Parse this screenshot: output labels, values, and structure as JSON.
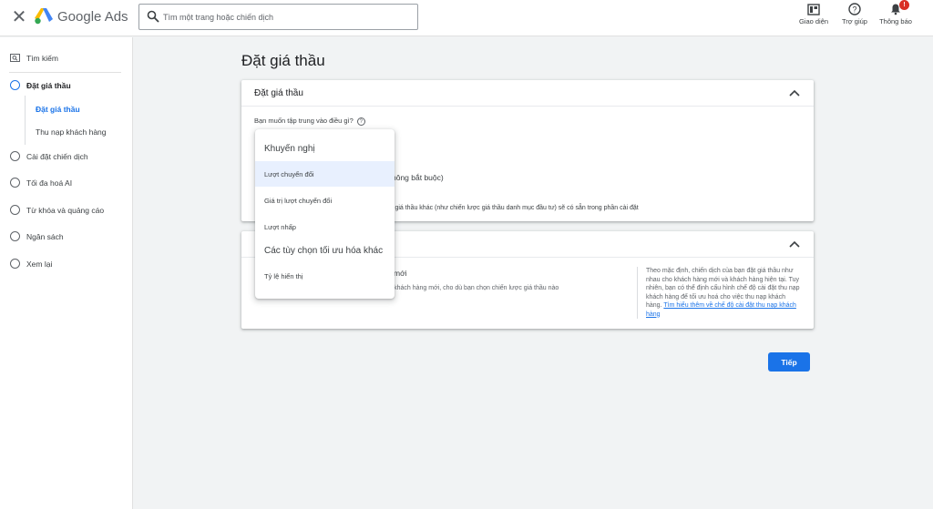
{
  "topbar": {
    "brand": "Google Ads",
    "search_placeholder": "Tìm một trang hoặc chiến dịch",
    "appearance_label": "Giao diện",
    "help_label": "Trợ giúp",
    "notifications_label": "Thông báo",
    "notifications_badge": "!"
  },
  "sidebar": {
    "search_label": "Tìm kiếm",
    "items": [
      {
        "label": "Đặt giá thầu"
      },
      {
        "label": "Cài đặt chiến dịch"
      },
      {
        "label": "Tối đa hoá AI"
      },
      {
        "label": "Từ khóa và quảng cáo"
      },
      {
        "label": "Ngân sách"
      },
      {
        "label": "Xem lại"
      }
    ],
    "sub_items": [
      {
        "label": "Đặt giá thầu"
      },
      {
        "label": "Thu nạp khách hàng"
      }
    ]
  },
  "main": {
    "page_title": "Đặt giá thầu",
    "card1": {
      "title": "Đặt giá thầu",
      "question": "Bạn muốn tập trung vào điều gì?",
      "help_icon": "?",
      "partial_optional": "hông bắt buộc)",
      "partial_note": "c giá thầu khác (như chiến lược giá thầu danh mục đầu tư) sẽ có sẵn trong phần cài đặt"
    },
    "card2": {
      "partial_title": "mới",
      "partial_desc": "ới khách hàng mới, cho dù bạn chọn chiến lược giá thầu nào",
      "side_note": "Theo mặc định, chiến dịch của bạn đặt giá thầu như nhau cho khách hàng mới và khách hàng hiện tại. Tuy nhiên, bạn có thể định cấu hình chế độ cài đặt thu nạp khách hàng để tối ưu hoá cho việc thu nạp khách hàng.",
      "side_link": "Tìm hiểu thêm về chế độ cài đặt thu nạp khách hàng"
    },
    "next_button": "Tiếp"
  },
  "dropdown": {
    "group_recommended": "Khuyến nghị",
    "options_recommended": [
      {
        "label": "Lượt chuyển đổi"
      },
      {
        "label": "Giá trị lượt chuyển đổi"
      },
      {
        "label": "Lượt nhấp"
      }
    ],
    "group_other": "Các tùy chọn tối ưu hóa khác",
    "options_other": [
      {
        "label": "Tỷ lệ hiển thị"
      }
    ],
    "selected": "Lượt chuyển đổi"
  },
  "colors": {
    "accent": "#1a73e8",
    "selected_bg": "#e8f0fe",
    "badge": "#d93025"
  },
  "icons": [
    "close-icon",
    "google-ads-logo",
    "search-icon",
    "appearance-icon",
    "help-icon",
    "bell-icon",
    "chevron-up-icon",
    "radio-circle-icon"
  ]
}
